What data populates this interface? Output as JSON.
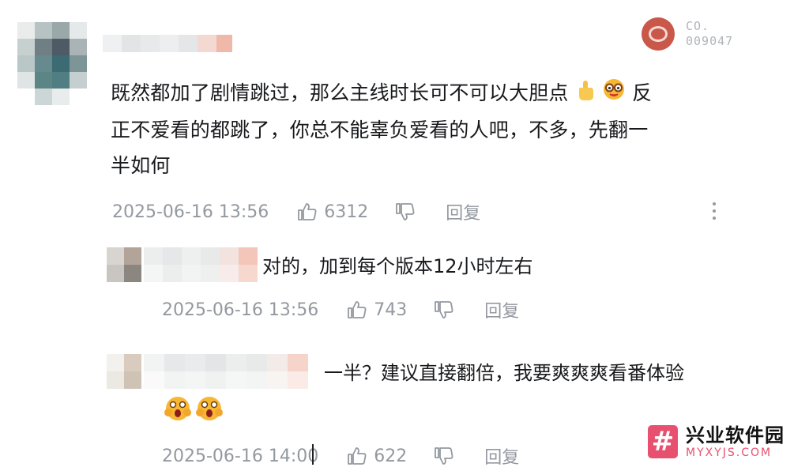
{
  "badge": {
    "line1": "CO.",
    "line2": "009047"
  },
  "comment": {
    "text_line1": "既然都加了剧情跳过，那么主线时长可不可以大胆点",
    "text_line1_end": "反",
    "text_line2": "正不爱看的都跳了，你总不能辜负爱看的人吧，不多，先翻一",
    "text_line3": "半如何",
    "emojis": [
      "pointing-up-emoji",
      "glasses-face-emoji"
    ],
    "time": "2025-06-16 13:56",
    "likes": "6312",
    "reply_label": "回复"
  },
  "replies": [
    {
      "text": "对的，加到每个版本12小时左右",
      "time": "2025-06-16 13:56",
      "likes": "743",
      "reply_label": "回复"
    },
    {
      "text": "一半？建议直接翻倍，我要爽爽爽看番体验",
      "emojis": [
        "screaming-face-emoji",
        "screaming-face-emoji"
      ],
      "time": "2025-06-16 14:00",
      "likes": "622",
      "reply_label": "回复"
    }
  ],
  "watermark": {
    "cn": "兴业软件园",
    "en": "MYXYJS.COM"
  },
  "colors": {
    "meta": "#9499a0",
    "text": "#18191c",
    "watermark_pink": "#e8506f"
  }
}
